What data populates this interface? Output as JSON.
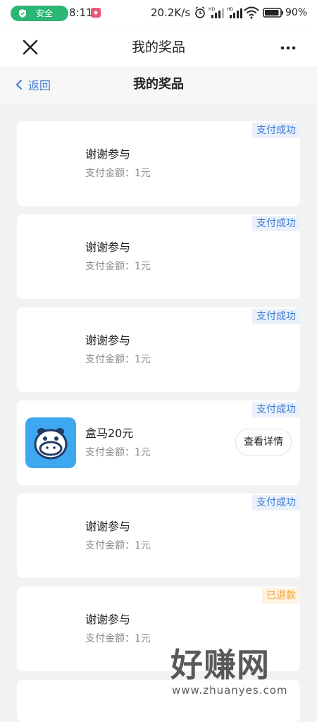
{
  "status_bar": {
    "safe_label": "安全",
    "time": "8:11",
    "net_speed": "20.2K/s",
    "battery_pct": "90%",
    "accent": "#2bb673"
  },
  "header": {
    "title": "我的奖品",
    "close_icon": "close-icon",
    "more_icon": "more-dots-icon"
  },
  "subheader": {
    "back_label": "返回",
    "title": "我的奖品",
    "accent": "#3a7bd5"
  },
  "prizes": [
    {
      "status": "支付成功",
      "title": "谢谢参与",
      "amount": "支付金额：1元"
    },
    {
      "status": "支付成功",
      "title": "谢谢参与",
      "amount": "支付金额：1元"
    },
    {
      "status": "支付成功",
      "title": "谢谢参与",
      "amount": "支付金额：1元"
    },
    {
      "status": "支付成功",
      "title": "盒马20元",
      "amount": "支付金额：1元",
      "icon": "hippo-icon",
      "detail_button": "查看详情"
    },
    {
      "status": "支付成功",
      "title": "谢谢参与",
      "amount": "支付金额：1元"
    },
    {
      "status": "已退款",
      "title": "谢谢参与",
      "amount": "支付金额：1元"
    }
  ],
  "watermark": {
    "big": "好赚网",
    "small": "www.zhuanyes.com"
  }
}
